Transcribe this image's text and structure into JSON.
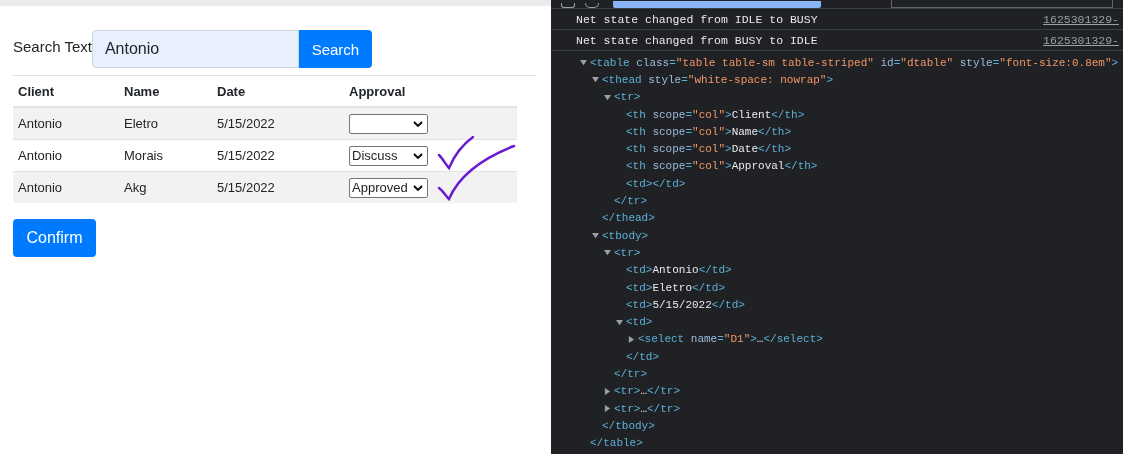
{
  "page": {
    "search_label": "Search Text",
    "search_field": {
      "value": "Antonio"
    },
    "search_button": "Search",
    "table": {
      "columns": [
        "Client",
        "Name",
        "Date",
        "Approval"
      ],
      "rows": [
        {
          "client": "Antonio",
          "name": "Eletro",
          "date": "5/15/2022",
          "approval": {}
        },
        {
          "client": "Antonio",
          "name": "Morais",
          "date": "5/15/2022",
          "approval": {
            "value": "Discuss"
          }
        },
        {
          "client": "Antonio",
          "name": "Akg",
          "date": "5/15/2022",
          "approval": {
            "value": "Approved"
          }
        }
      ]
    },
    "confirm_button": "Confirm"
  },
  "devtools": {
    "console": [
      {
        "message": "Net state changed from IDLE to BUSY",
        "source": "1625301329-"
      },
      {
        "message": "Net state changed from BUSY to IDLE",
        "source": "1625301329-"
      }
    ],
    "elements_tree": [
      {
        "tokens": [
          {
            "tag": "<table"
          },
          {
            "attr": " class"
          },
          {
            "tag": "="
          },
          {
            "value": "\"table table-sm table-striped\""
          },
          {
            "attr": " id"
          },
          {
            "tag": "="
          },
          {
            "value": "\"dtable\""
          },
          {
            "attr": " style"
          },
          {
            "tag": "="
          },
          {
            "value": "\"font-size:0.8em\""
          },
          {
            "tag": ">"
          }
        ],
        "expanded": true,
        "children": [
          {
            "tokens": [
              {
                "tag": "<thead"
              },
              {
                "attr": " style"
              },
              {
                "tag": "="
              },
              {
                "value": "\"white-space: nowrap\""
              },
              {
                "tag": ">"
              }
            ],
            "expanded": true,
            "children": [
              {
                "tokens": [
                  {
                    "tag": "<tr>"
                  }
                ],
                "expanded": true,
                "children": [
                  {
                    "tokens": [
                      {
                        "tag": "<th"
                      },
                      {
                        "attr": " scope"
                      },
                      {
                        "tag": "="
                      },
                      {
                        "value": "\"col\""
                      },
                      {
                        "tag": ">"
                      },
                      {
                        "text": "Client"
                      },
                      {
                        "tag": "</th>"
                      }
                    ]
                  },
                  {
                    "tokens": [
                      {
                        "tag": "<th"
                      },
                      {
                        "attr": " scope"
                      },
                      {
                        "tag": "="
                      },
                      {
                        "value": "\"col\""
                      },
                      {
                        "tag": ">"
                      },
                      {
                        "text": "Name"
                      },
                      {
                        "tag": "</th>"
                      }
                    ]
                  },
                  {
                    "tokens": [
                      {
                        "tag": "<th"
                      },
                      {
                        "attr": " scope"
                      },
                      {
                        "tag": "="
                      },
                      {
                        "value": "\"col\""
                      },
                      {
                        "tag": ">"
                      },
                      {
                        "text": "Date"
                      },
                      {
                        "tag": "</th>"
                      }
                    ]
                  },
                  {
                    "tokens": [
                      {
                        "tag": "<th"
                      },
                      {
                        "attr": " scope"
                      },
                      {
                        "tag": "="
                      },
                      {
                        "value": "\"col\""
                      },
                      {
                        "tag": ">"
                      },
                      {
                        "text": "Approval"
                      },
                      {
                        "tag": "</th>"
                      }
                    ]
                  },
                  {
                    "tokens": [
                      {
                        "tag": "<td></td>"
                      }
                    ]
                  }
                ],
                "close": "</tr>"
              }
            ],
            "close": "</thead>"
          },
          {
            "tokens": [
              {
                "tag": "<tbody>"
              }
            ],
            "expanded": true,
            "children": [
              {
                "tokens": [
                  {
                    "tag": "<tr>"
                  }
                ],
                "expanded": true,
                "children": [
                  {
                    "tokens": [
                      {
                        "tag": "<td>"
                      },
                      {
                        "text": "Antonio"
                      },
                      {
                        "tag": "</td>"
                      }
                    ]
                  },
                  {
                    "tokens": [
                      {
                        "tag": "<td>"
                      },
                      {
                        "text": "Eletro"
                      },
                      {
                        "tag": "</td>"
                      }
                    ]
                  },
                  {
                    "tokens": [
                      {
                        "tag": "<td>"
                      },
                      {
                        "text": "5/15/2022"
                      },
                      {
                        "tag": "</td>"
                      }
                    ]
                  },
                  {
                    "tokens": [
                      {
                        "tag": "<td>"
                      }
                    ],
                    "expanded": true,
                    "children": [
                      {
                        "tokens": [
                          {
                            "tag": "<select"
                          },
                          {
                            "attr": " name"
                          },
                          {
                            "tag": "="
                          },
                          {
                            "value": "\"D1\""
                          },
                          {
                            "tag": ">"
                          },
                          {
                            "text": "…"
                          },
                          {
                            "tag": "</select>"
                          }
                        ],
                        "expanded": false
                      }
                    ],
                    "close": "</td>"
                  }
                ],
                "close": "</tr>"
              },
              {
                "tokens": [
                  {
                    "tag": "<tr>"
                  },
                  {
                    "text": "…"
                  },
                  {
                    "tag": "</tr>"
                  }
                ],
                "expanded": false
              },
              {
                "tokens": [
                  {
                    "tag": "<tr>"
                  },
                  {
                    "text": "…"
                  },
                  {
                    "tag": "</tr>"
                  }
                ],
                "expanded": false
              }
            ],
            "close": "</tbody>"
          }
        ],
        "close": "</table>"
      }
    ]
  }
}
